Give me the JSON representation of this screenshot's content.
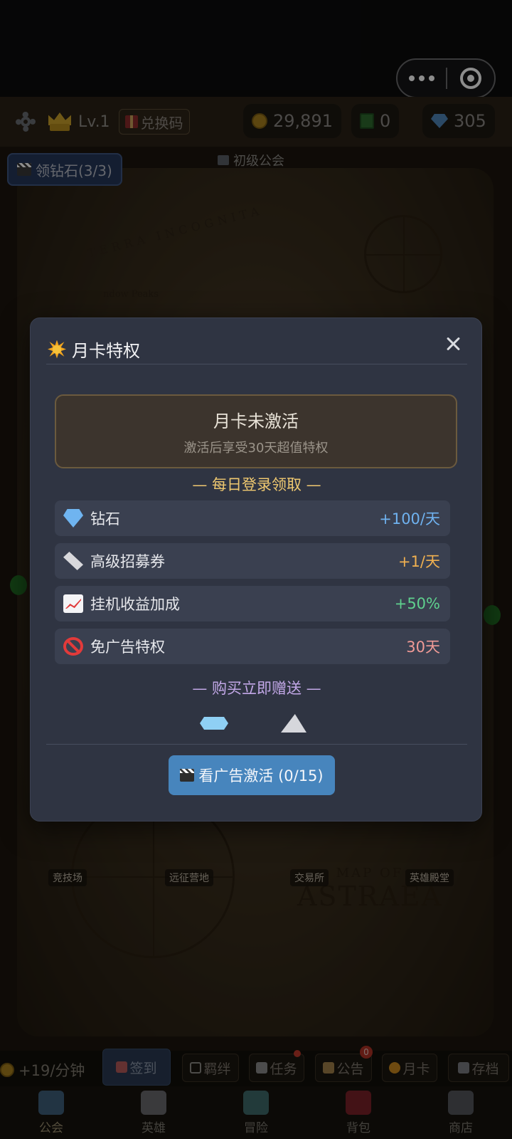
{
  "topbar": {
    "level": "Lv.1",
    "redeem_label": "兑换码",
    "gold": "29,891",
    "jade": "0",
    "diamonds": "305"
  },
  "map": {
    "claim_diamond_label": "领钻石(3/3)",
    "guild_rank": "初级公会",
    "terra": "TERRA INCOGNITA",
    "peaks": "ndow Peaks",
    "title_small": "MAP OF",
    "title": "ASTRAEA",
    "locations": [
      "竞技场",
      "远征营地",
      "交易所",
      "英雄殿堂"
    ]
  },
  "modal": {
    "title": "月卡特权",
    "status_title": "月卡未激活",
    "status_sub": "激活后享受30天超值特权",
    "daily_label": "— 每日登录领取 —",
    "rows": [
      {
        "label": "钻石",
        "value": "+100/天",
        "color": "#6fb2f0"
      },
      {
        "label": "高级招募券",
        "value": "+1/天",
        "color": "#f0b050"
      },
      {
        "label": "挂机收益加成",
        "value": "+50%",
        "color": "#5fd18e"
      },
      {
        "label": "免广告特权",
        "value": "30天",
        "color": "#f09a96"
      }
    ],
    "gift_label": "— 购买立即赠送 —",
    "ad_button": "看广告激活 (0/15)"
  },
  "actions": {
    "income": "+19/分钟",
    "signin": "签到",
    "bond": "羁绊",
    "task": "任务",
    "notice": "公告",
    "notice_badge": "0",
    "monthcard": "月卡",
    "save": "存档"
  },
  "nav": [
    "公会",
    "英雄",
    "冒险",
    "背包",
    "商店"
  ]
}
